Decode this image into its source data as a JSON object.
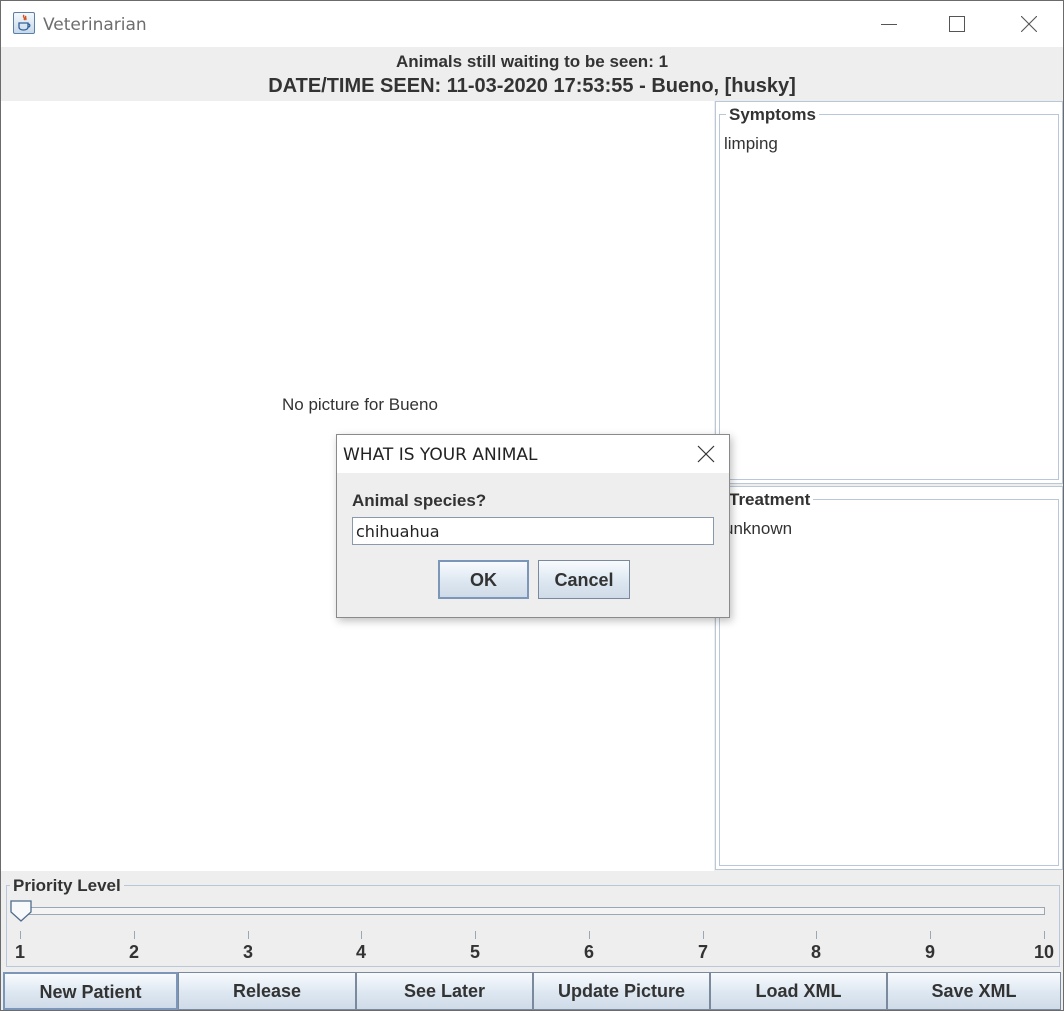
{
  "window": {
    "title": "Veterinarian"
  },
  "header": {
    "waiting_text": "Animals still waiting to be seen: 1",
    "seen_text": "DATE/TIME SEEN: 11-03-2020 17:53:55 - Bueno, [husky]"
  },
  "picture": {
    "message": "No picture for Bueno"
  },
  "symptoms": {
    "title": "Symptoms",
    "text": "limping"
  },
  "treatment": {
    "title": "Treatment",
    "text": "unknown"
  },
  "priority": {
    "title": "Priority Level",
    "value": 1,
    "min": 1,
    "max": 10,
    "tick_labels": [
      "1",
      "2",
      "3",
      "4",
      "5",
      "6",
      "7",
      "8",
      "9",
      "10"
    ]
  },
  "buttons": {
    "new_patient": "New Patient",
    "release": "Release",
    "see_later": "See Later",
    "update_picture": "Update Picture",
    "load_xml": "Load XML",
    "save_xml": "Save XML"
  },
  "dialog": {
    "title": "WHAT IS YOUR ANIMAL",
    "prompt": "Animal species?",
    "input_value": "chihuahua",
    "ok_label": "OK",
    "cancel_label": "Cancel"
  },
  "icons": {
    "app": "java-coffee-cup-icon",
    "minimize": "minimize-icon",
    "maximize": "maximize-icon",
    "close": "close-icon",
    "slider_thumb": "slider-thumb-icon"
  },
  "colors": {
    "panel_border": "#b8c8d8",
    "button_gradient_top": "#f8fbfe",
    "button_gradient_bottom": "#cfdbe8",
    "focus_border": "#7b96b8"
  }
}
